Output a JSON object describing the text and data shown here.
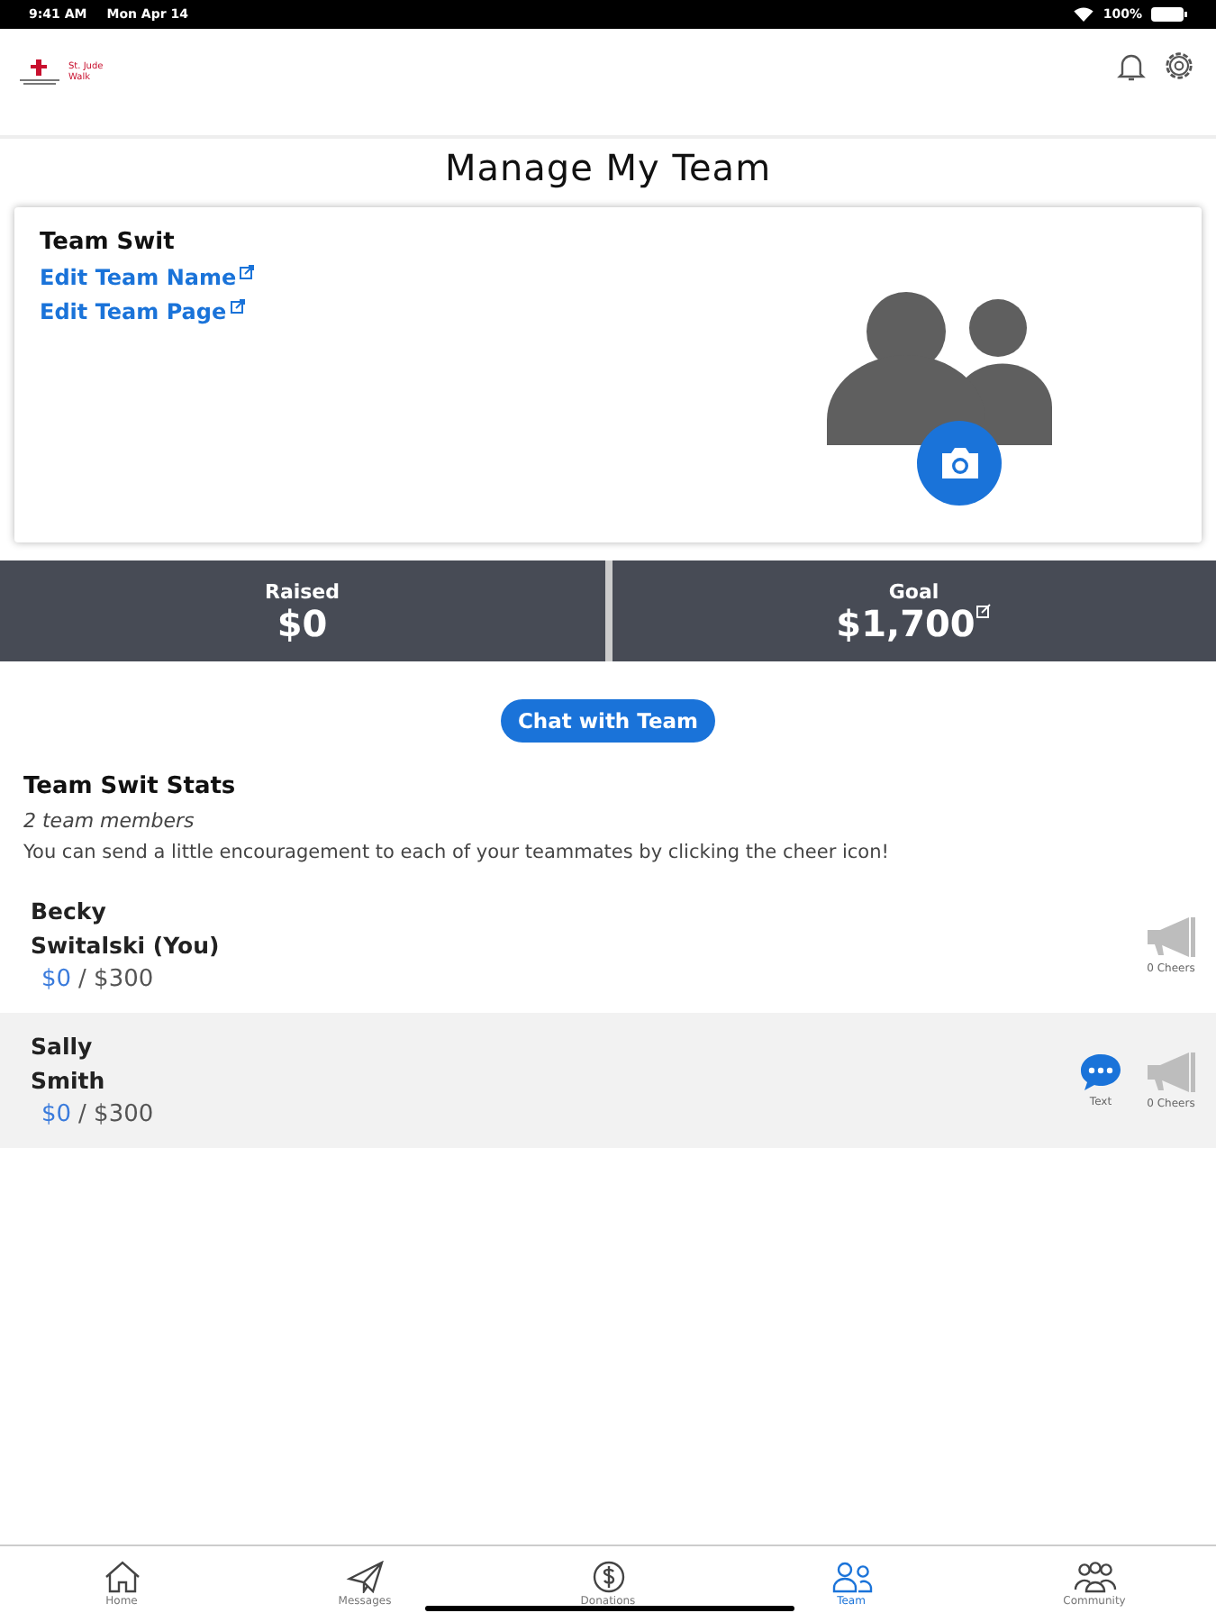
{
  "status_bar": {
    "time": "9:41 AM",
    "date": "Mon Apr 14",
    "battery": "100%"
  },
  "logo": {
    "line1": "St. Jude",
    "line2": "Walk"
  },
  "page_title": "Manage My Team",
  "team_card": {
    "name": "Team Swit",
    "links": [
      "Edit Team Name",
      "Edit Team Page"
    ]
  },
  "totals": [
    {
      "label": "Raised",
      "value": "$0",
      "editable": false
    },
    {
      "label": "Goal",
      "value": "$1,700",
      "editable": true
    }
  ],
  "chat_button": "Chat with Team",
  "stats": {
    "title": "Team Swit Stats",
    "members": "2 team members",
    "hint": "You can send a little encouragement to each of your teammates by clicking the cheer icon!"
  },
  "members": [
    {
      "first": "Becky",
      "last": "Switalski (You)",
      "raised": "$0",
      "goal": "/ $300",
      "can_text": false,
      "cheers": "0 Cheers",
      "selected": false
    },
    {
      "first": "Sally",
      "last": "Smith",
      "raised": "$0",
      "goal": "/ $300",
      "can_text": true,
      "text_label": "Text",
      "cheers": "0 Cheers",
      "selected": true
    }
  ],
  "tab_bar": [
    {
      "label": "Home",
      "kind": "home",
      "selected": false
    },
    {
      "label": "Messages",
      "kind": "send",
      "selected": false
    },
    {
      "label": "Donations",
      "kind": "money",
      "selected": false
    },
    {
      "label": "Team",
      "kind": "team",
      "selected": true
    },
    {
      "label": "Community",
      "kind": "community",
      "selected": false
    }
  ]
}
